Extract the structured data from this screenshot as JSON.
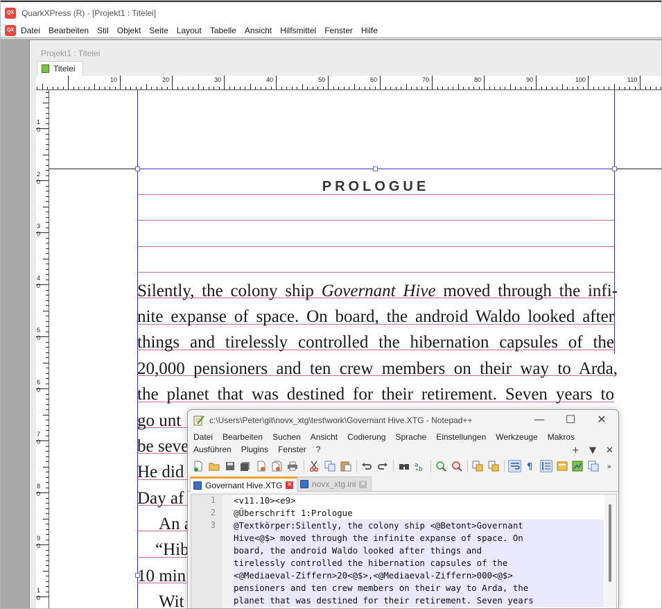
{
  "quark": {
    "app_icon": "QX",
    "window_title": "QuarkXPress (R) - [Projekt1 : Titelei]",
    "menu": [
      "Datei",
      "Bearbeiten",
      "Stil",
      "Objekt",
      "Seite",
      "Layout",
      "Tabelle",
      "Ansicht",
      "Hilfsmittel",
      "Fenster",
      "Hilfe"
    ],
    "doc_title": "Projekt1 : Titelei",
    "doc_tab": "Titelei",
    "ruler_h_labels": [
      "10",
      "20",
      "30",
      "40",
      "50",
      "60",
      "70",
      "80",
      "90",
      "100",
      "110"
    ],
    "ruler_v_labels": [
      "1 0",
      "2 0",
      "3 0",
      "4 0",
      "5 0",
      "6 0",
      "7 0",
      "8 0",
      "9 0",
      "1 0"
    ],
    "heading": "PROLOGUE",
    "body_lines": [
      {
        "before": "Silently, the colony ship ",
        "italic": "Governant Hive",
        "after": " moved through the infi-"
      },
      {
        "text": "nite expanse of space. On board, the android Waldo looked after"
      },
      {
        "text": "things and tirelessly controlled the hibernation capsules of the"
      },
      {
        "text": "20,000 pensioners and ten crew members on their way to Arda,"
      },
      {
        "text": "the planet that was destined for their retirement. Seven years to"
      },
      {
        "text": "go unt"
      },
      {
        "text": "be seve"
      },
      {
        "text": "He did"
      },
      {
        "text": "Day af"
      },
      {
        "text": "An a"
      },
      {
        "text": "“Hib"
      },
      {
        "text": "10 min"
      },
      {
        "text": "Wit"
      }
    ]
  },
  "notepad": {
    "window_title": "c:\\Users\\Peter\\git\\novx_xtg\\test\\work\\Governant Hive.XTG - Notepad++",
    "minimize": "—",
    "maximize": "☐",
    "close": "✕",
    "menu_row1": [
      "Datei",
      "Bearbeiten",
      "Suchen",
      "Ansicht",
      "Codierung",
      "Sprache",
      "Einstellungen",
      "Werkzeuge",
      "Makros"
    ],
    "menu_row2": [
      "Ausführen",
      "Plugins",
      "Fenster",
      "?"
    ],
    "menu_ctrl": [
      "+",
      "▼",
      "✕"
    ],
    "tabs": [
      {
        "label": "Governant Hive.XTG",
        "active": true
      },
      {
        "label": "novx_xtg.ini",
        "active": false
      }
    ],
    "line_numbers": [
      "1",
      "2",
      "3"
    ],
    "code_lines": [
      "<v11.10><e9>",
      "@Überschrift 1:Prologue",
      "@Textkörper:Silently, the colony ship <@Betont>Governant",
      "Hive<@$> moved through the infinite expanse of space. On",
      "board, the android Waldo looked after things and",
      "tirelessly controlled the hibernation capsules of the",
      "<@Mediaeval-Ziffern>20<@$>,<@Mediaeval-Ziffern>000<@$>",
      "pensioners and ten crew members on their way to Arda, the",
      "planet that was destined for their retirement. Seven years"
    ],
    "toolbar_icons": [
      "new-file-icon",
      "open-file-icon",
      "save-icon",
      "save-all-icon",
      "close-icon",
      "close-all-icon",
      "print-icon",
      "cut-icon",
      "copy-icon",
      "paste-icon",
      "undo-icon",
      "redo-icon",
      "find-icon",
      "replace-icon",
      "zoom-in-icon",
      "zoom-out-icon",
      "sync-v-icon",
      "sync-h-icon",
      "word-wrap-icon",
      "show-all-chars-icon",
      "indent-guide-icon",
      "udl-icon",
      "doc-map-icon",
      "function-list-icon",
      "more-icon"
    ]
  },
  "colors": {
    "margin_guide": "#2a2acc",
    "baseline_grid": "#c86aa0",
    "tab_accent": "#f0a030",
    "highlight_line": "#e8e8ff"
  }
}
